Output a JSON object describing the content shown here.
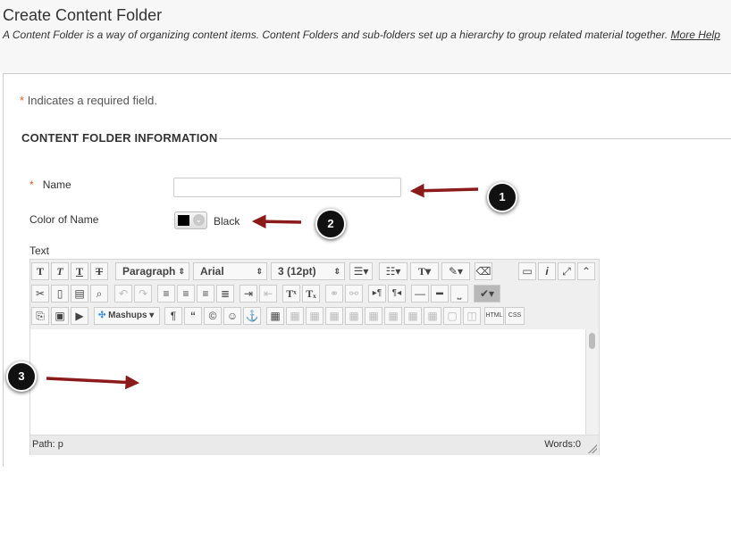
{
  "header": {
    "title": "Create Content Folder",
    "description": "A Content Folder is a way of organizing content items. Content Folders and sub-folders set up a hierarchy to group related material together.",
    "help_link": "More Help"
  },
  "form": {
    "required_marker": "*",
    "required_note": "Indicates a required field.",
    "section_title": "CONTENT FOLDER INFORMATION",
    "name_label": "Name",
    "name_value": "",
    "color_label": "Color of Name",
    "color_value": "Black",
    "color_swatch": "#000000",
    "text_label": "Text"
  },
  "editor": {
    "format_select": "Paragraph",
    "font_select": "Arial",
    "size_select": "3 (12pt)",
    "mashups_label": "Mashups",
    "html_label": "HTML",
    "css_label": "CSS",
    "path_text": "Path: p",
    "word_count": "Words:0"
  },
  "callouts": [
    "1",
    "2",
    "3"
  ],
  "colors": {
    "accent": "#e2611f",
    "arrow": "#8b1a1a"
  }
}
